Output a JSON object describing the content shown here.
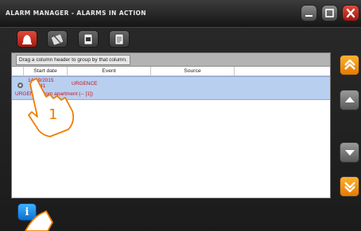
{
  "window": {
    "title": "ALARM MANAGER - ALARMS IN ACTION"
  },
  "window_controls": {
    "minimize_icon": "minimize-icon",
    "maximize_icon": "maximize-icon",
    "close_icon": "close-icon"
  },
  "toolbar": {
    "buttons": [
      {
        "icon": "alarm-bell-icon",
        "active": true
      },
      {
        "icon": "speaker-muted-icon",
        "active": false
      },
      {
        "icon": "report-icon",
        "active": false
      },
      {
        "icon": "document-icon",
        "active": false
      }
    ]
  },
  "grid": {
    "group_hint": "Drag a column header to group by that column.",
    "columns": [
      "Start date",
      "Event",
      "Source"
    ],
    "rows": [
      {
        "date": "14/09/2015",
        "time": "21:41",
        "event": "URGENCE",
        "source": "",
        "detail": "URGENCE from apartment (-- [1])",
        "icon": "alarm-row-icon"
      }
    ]
  },
  "sidebar": {
    "buttons": [
      "scroll-top-icon",
      "scroll-up-icon",
      "scroll-down-icon",
      "scroll-bottom-icon"
    ]
  },
  "bottom": {
    "info_label": "i"
  },
  "annotation": {
    "step": "1",
    "color": "#f07d00"
  },
  "colors": {
    "accent_red": "#c8151d",
    "selection": "#b9cff0",
    "orange": "#e57a00"
  }
}
